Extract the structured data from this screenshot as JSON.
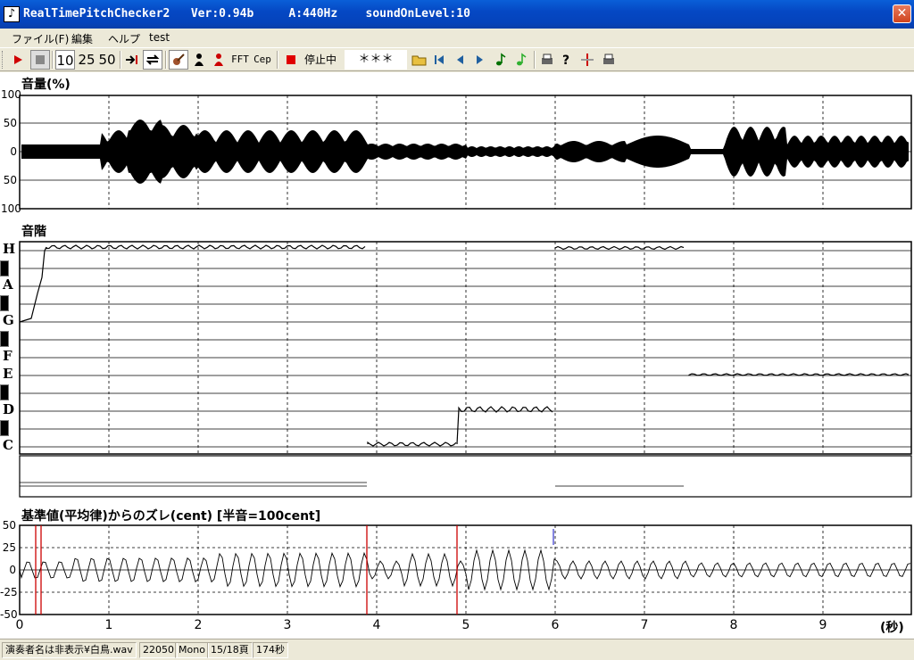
{
  "window": {
    "title": "RealTimePitchChecker2   Ver:0.94b     A:440Hz    soundOnLevel:10",
    "close_glyph": "✕"
  },
  "menu": [
    "ファイル(F)",
    "編集",
    "ヘルプ",
    "test"
  ],
  "toolbar": {
    "zoom_10": "10",
    "zoom_25": "25",
    "zoom_50": "50",
    "fft": "FFT",
    "cep": "Cep",
    "status": "停止中",
    "stars": "＊＊＊"
  },
  "volume_panel": {
    "title": "音量(%)",
    "y_ticks": [
      "100",
      "50",
      "0",
      "50",
      "100"
    ]
  },
  "scale_panel": {
    "title": "音階",
    "notes": [
      "H",
      "A",
      "G",
      "F",
      "E",
      "D",
      "C"
    ]
  },
  "deviation_panel": {
    "title": "基準値(平均律)からのズレ(cent) [半音=100cent]",
    "y_ticks": [
      "50",
      "25",
      "0",
      "-25",
      "-50"
    ]
  },
  "x_axis": {
    "ticks": [
      "0",
      "1",
      "2",
      "3",
      "4",
      "5",
      "6",
      "7",
      "8",
      "9"
    ],
    "unit": "(秒)"
  },
  "status_bar": {
    "file": "演奏者名は非表示¥白鳥.wav",
    "rate": "22050",
    "channels": "Mono",
    "page": "15/18頁",
    "duration": "174秒"
  },
  "colors": {
    "title_bar": "#0548c4",
    "deviation_spike": "#cc0000",
    "deviation_marker": "#3333cc"
  },
  "icons": [
    "play-icon",
    "stop-icon",
    "jump-end-icon",
    "loop-icon",
    "violin-icon",
    "singer-icon",
    "singer-red-icon",
    "record-icon",
    "open-folder-icon",
    "first-page-icon",
    "prev-page-icon",
    "next-page-icon",
    "note-icon",
    "note2-icon",
    "print-icon",
    "help-icon",
    "marker-icon",
    "print2-icon"
  ]
}
